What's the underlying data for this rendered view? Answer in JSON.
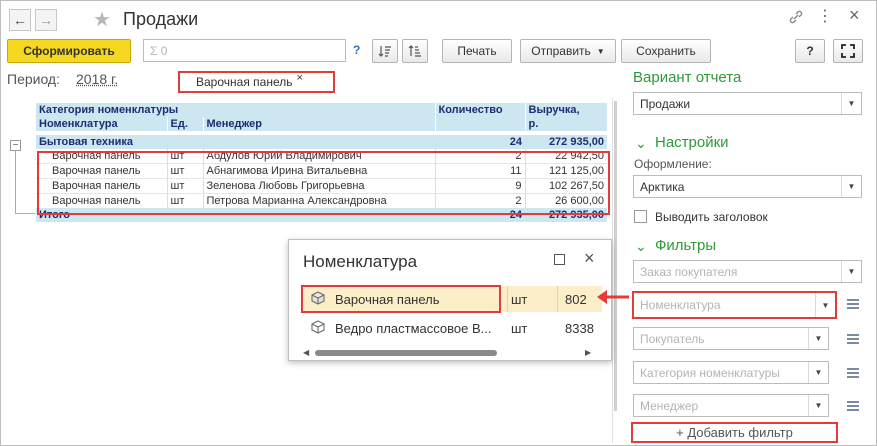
{
  "window": {
    "title": "Продажи",
    "back_icon": "arrow-left-icon",
    "forward_icon": "arrow-right-icon",
    "star_icon": "star-icon"
  },
  "toolbar": {
    "generate": "Сформировать",
    "search_placeholder": "Σ 0",
    "help": "?",
    "print": "Печать",
    "send": "Отправить",
    "save": "Сохранить",
    "help_right": "?"
  },
  "period": {
    "label": "Период:",
    "value": "2018 г."
  },
  "filter_tag": {
    "label": "Варочная панель",
    "close": "×"
  },
  "report": {
    "headers": {
      "category": "Категория номенклатуры",
      "item": "Номенклатура",
      "unit": "Ед.",
      "manager": "Менеджер",
      "quantity": "Количество",
      "revenue_line1": "Выручка,",
      "revenue_line2": "р."
    },
    "group": {
      "name": "Бытовая техника",
      "quantity": "24",
      "revenue": "272 935,00"
    },
    "rows": [
      {
        "item": "Варочная панель",
        "unit": "шт",
        "manager": "Абдулов Юрий Владимирович",
        "quantity": "2",
        "revenue": "22 942,50"
      },
      {
        "item": "Варочная панель",
        "unit": "шт",
        "manager": "Абнагимова Ирина Витальевна",
        "quantity": "11",
        "revenue": "121 125,00"
      },
      {
        "item": "Варочная панель",
        "unit": "шт",
        "manager": "Зеленова Любовь Григорьевна",
        "quantity": "9",
        "revenue": "102 267,50"
      },
      {
        "item": "Варочная панель",
        "unit": "шт",
        "manager": "Петрова Марианна Александровна",
        "quantity": "2",
        "revenue": "26 600,00"
      }
    ],
    "total": {
      "label": "Итого",
      "quantity": "24",
      "revenue": "272 935,00"
    }
  },
  "popup": {
    "title": "Номенклатура",
    "items": [
      {
        "name": "Варочная панель",
        "unit": "шт",
        "value": "802"
      },
      {
        "name": "Ведро пластмассовое В...",
        "unit": "шт",
        "value": "8338"
      }
    ]
  },
  "panel": {
    "variant_title": "Вариант отчета",
    "variant_value": "Продажи",
    "settings_title": "Настройки",
    "design_label": "Оформление:",
    "design_value": "Арктика",
    "show_header": "Выводить заголовок",
    "filters_title": "Фильтры",
    "filters": [
      "Заказ покупателя",
      "Номенклатура",
      "Покупатель",
      "Категория номенклатуры",
      "Менеджер"
    ],
    "add_filter": "+ Добавить фильтр"
  },
  "colors": {
    "accent_yellow": "#f6d821",
    "header_blue": "#cde6ef",
    "header_text": "#1b2f73",
    "highlight_red": "#e23b3b",
    "section_green": "#2e9a3a"
  }
}
